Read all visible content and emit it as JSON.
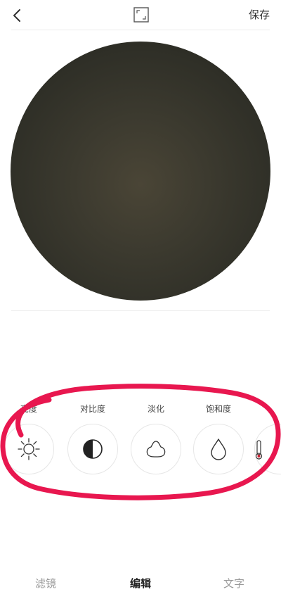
{
  "topbar": {
    "back_icon": "chevron-left-icon",
    "crop_icon": "crop-frame-icon",
    "save_label": "保存"
  },
  "preview": {
    "shape": "circle",
    "colors": [
      "#4a4536",
      "#24241e"
    ]
  },
  "tools": [
    {
      "label": "亮度",
      "icon": "brightness-sun-icon"
    },
    {
      "label": "对比度",
      "icon": "contrast-half-circle-icon"
    },
    {
      "label": "淡化",
      "icon": "fade-blob-icon"
    },
    {
      "label": "饱和度",
      "icon": "saturation-drop-icon"
    },
    {
      "label": "",
      "icon": "temperature-thermometer-icon"
    }
  ],
  "annotation": {
    "color": "#e8174f",
    "shape": "hand-drawn-oval"
  },
  "tabs": [
    {
      "label": "滤镜",
      "active": false
    },
    {
      "label": "编辑",
      "active": true
    },
    {
      "label": "文字",
      "active": false
    }
  ]
}
